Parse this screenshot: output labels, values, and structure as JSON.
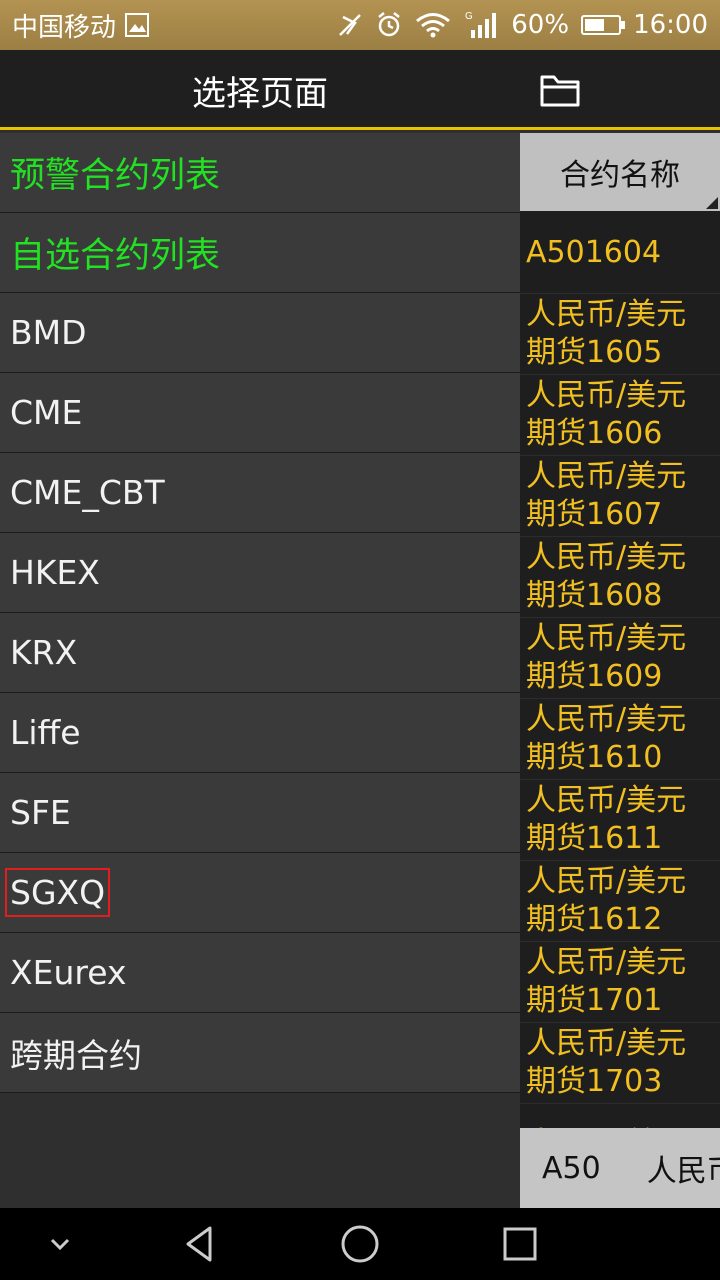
{
  "status_bar": {
    "carrier": "中国移动",
    "signal_label": "G",
    "battery_percent": "60%",
    "battery_level": 0.6,
    "time": "16:00"
  },
  "header": {
    "title": "选择页面",
    "folder_icon": "folder-icon"
  },
  "categories": [
    {
      "label": "预警合约列表",
      "highlight": "green"
    },
    {
      "label": "自选合约列表",
      "highlight": "green"
    },
    {
      "label": "BMD"
    },
    {
      "label": "CME"
    },
    {
      "label": "CME_CBT"
    },
    {
      "label": "HKEX"
    },
    {
      "label": "KRX"
    },
    {
      "label": "Liffe"
    },
    {
      "label": "SFE"
    },
    {
      "label": "SGXQ",
      "selected": true
    },
    {
      "label": "XEurex"
    },
    {
      "label": "跨期合约"
    }
  ],
  "contract_column": {
    "header": "合约名称",
    "cells": [
      "A501604",
      "人民币/美元\n期货1605",
      "人民币/美元\n期货1606",
      "人民币/美元\n期货1607",
      "人民币/美元\n期货1608",
      "人民币/美元\n期货1609",
      "人民币/美元\n期货1610",
      "人民币/美元\n期货1611",
      "人民币/美元\n期货1612",
      "人民币/美元\n期货1701",
      "人民币/美元\n期货1703",
      "人民币/美元"
    ]
  },
  "bottom_tabs": [
    "A50",
    "人民币"
  ],
  "colors": {
    "accent_yellow": "#e6c300",
    "green_text": "#22e022",
    "contract_text": "#f1bf20",
    "selection_border": "#e21d1d"
  }
}
